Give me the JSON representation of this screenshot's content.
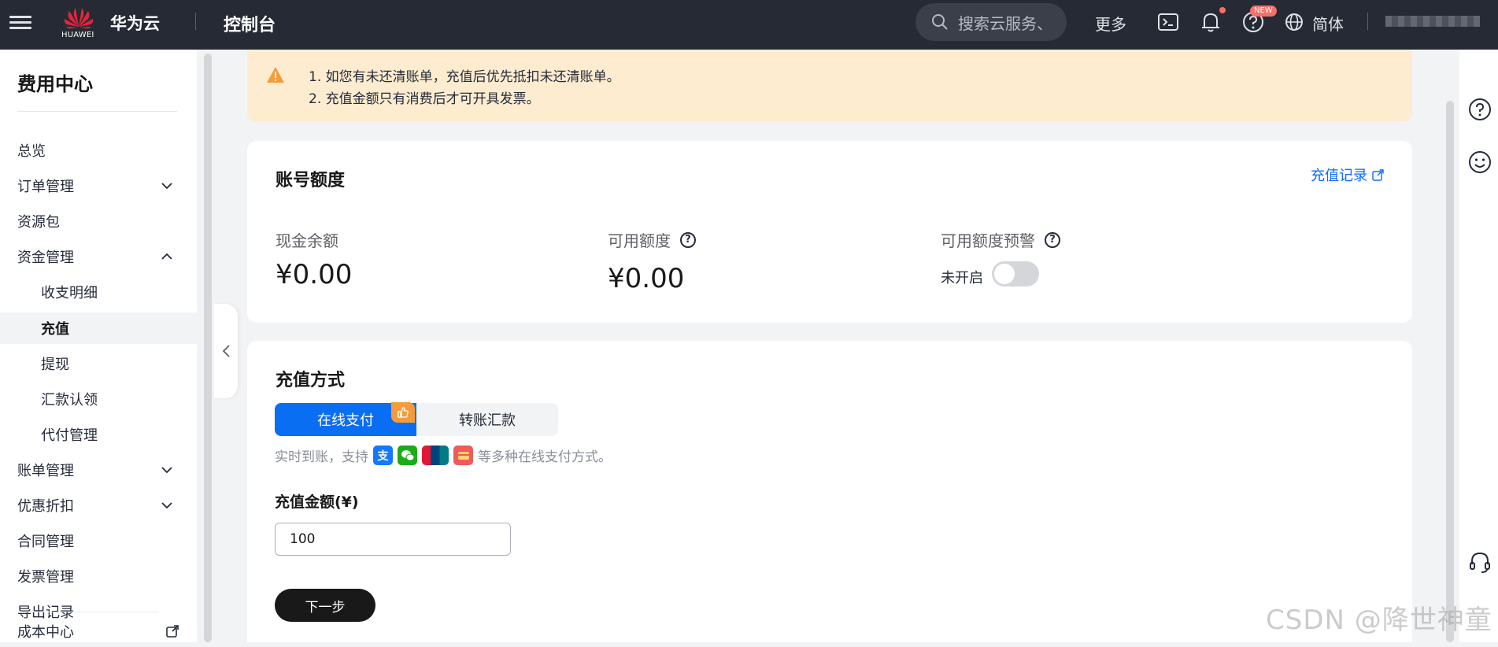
{
  "topbar": {
    "logo_text": "HUAWEI",
    "brand": "华为云",
    "console": "控制台",
    "search_placeholder": "搜索云服务、",
    "more": "更多",
    "new_badge": "NEW",
    "language": "简体"
  },
  "sidebar": {
    "title": "费用中心",
    "items": [
      {
        "label": "总览"
      },
      {
        "label": "订单管理"
      },
      {
        "label": "资源包"
      },
      {
        "label": "资金管理"
      },
      {
        "label": "收支明细"
      },
      {
        "label": "充值"
      },
      {
        "label": "提现"
      },
      {
        "label": "汇款认领"
      },
      {
        "label": "代付管理"
      },
      {
        "label": "账单管理"
      },
      {
        "label": "优惠折扣"
      },
      {
        "label": "合同管理"
      },
      {
        "label": "发票管理"
      },
      {
        "label": "导出记录"
      },
      {
        "label": "成本中心"
      }
    ]
  },
  "alert": {
    "line1": "1. 如您有未还清账单，充值后优先抵扣未还清账单。",
    "line2": "2. 充值金额只有消费后才可开具发票。"
  },
  "account": {
    "title": "账号额度",
    "recharge_records": "充值记录",
    "cash_balance_label": "现金余额",
    "cash_balance_value": "¥0.00",
    "available_label": "可用额度",
    "available_value": "¥0.00",
    "warning_label": "可用额度预警",
    "warning_status": "未开启"
  },
  "recharge": {
    "title": "充值方式",
    "tab_online": "在线支付",
    "tab_transfer": "转账汇款",
    "desc_prefix": "实时到账，支持",
    "desc_suffix": "等多种在线支付方式。",
    "amount_label": "充值金额(¥)",
    "amount_value": "100",
    "next_button": "下一步"
  },
  "watermark": "CSDN @降世神童",
  "colors": {
    "topbar": "#252a35",
    "primary": "#0a6ef2",
    "alert_bg": "#fdeccf",
    "warning": "#f59b3a"
  }
}
